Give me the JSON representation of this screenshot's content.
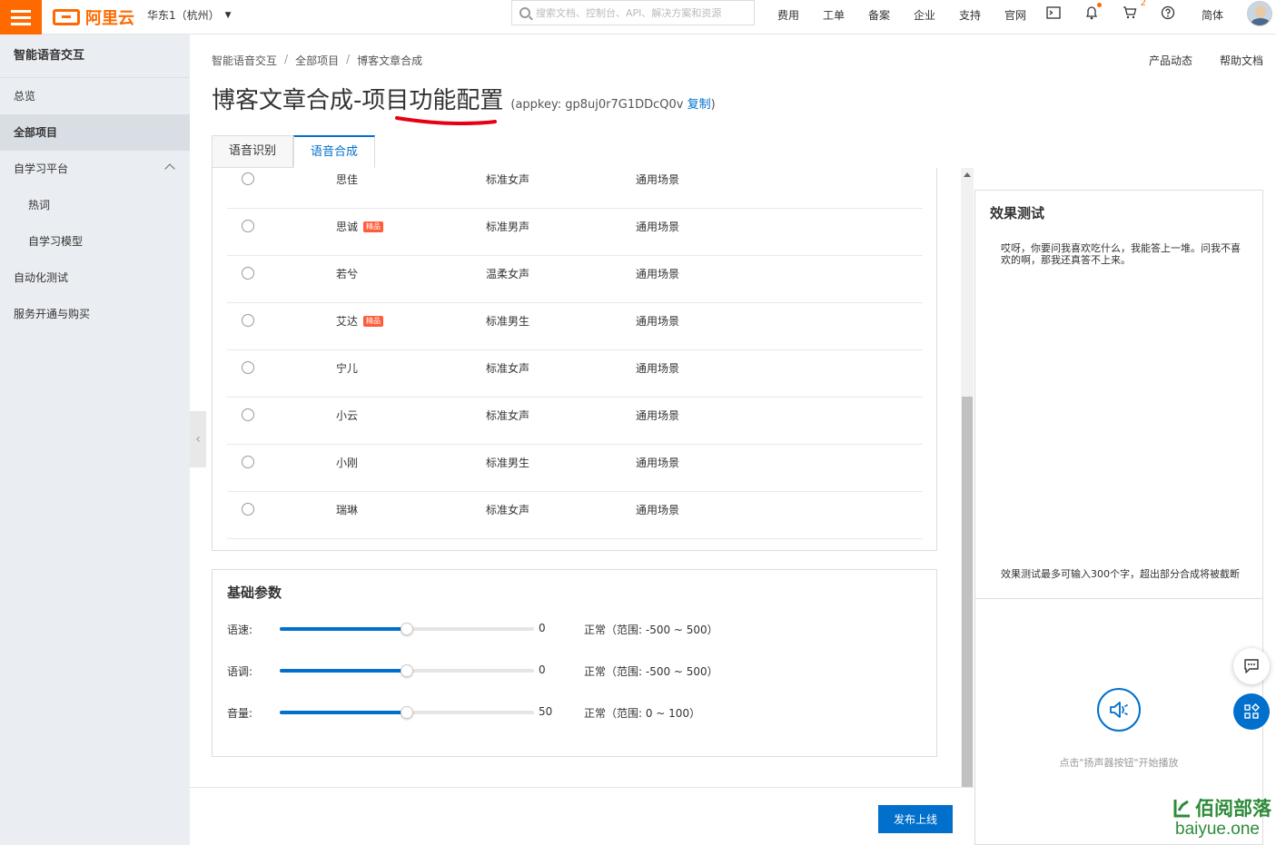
{
  "topbar": {
    "brand": "阿里云",
    "region": "华东1（杭州）",
    "search_placeholder": "搜索文档、控制台、API、解决方案和资源",
    "links": [
      "费用",
      "工单",
      "备案",
      "企业",
      "支持",
      "官网"
    ],
    "cart_badge": "2",
    "lang": "简体",
    "accent": "#ff6a00"
  },
  "sidebar": {
    "title": "智能语音交互",
    "items": [
      {
        "label": "总览"
      },
      {
        "label": "全部项目"
      },
      {
        "label": "自学习平台"
      },
      {
        "label": "热词"
      },
      {
        "label": "自学习模型"
      },
      {
        "label": "自动化测试"
      },
      {
        "label": "服务开通与购买"
      }
    ]
  },
  "breadcrumb": [
    "智能语音交互",
    "全部项目",
    "博客文章合成"
  ],
  "header_links": [
    "产品动态",
    "帮助文档"
  ],
  "title": {
    "text": "博客文章合成-项目功能配置",
    "appkey_prefix": "(appkey: gp8uj0r7G1DDcQ0v",
    "copy": "复制",
    "appkey_suffix": ")"
  },
  "tabs": [
    "语音识别",
    "语音合成"
  ],
  "tag_label": "精品",
  "voices": [
    {
      "name": "思佳",
      "type": "标准女声",
      "scene": "通用场景",
      "premium": false
    },
    {
      "name": "思诚",
      "type": "标准男声",
      "scene": "通用场景",
      "premium": true
    },
    {
      "name": "若兮",
      "type": "温柔女声",
      "scene": "通用场景",
      "premium": false
    },
    {
      "name": "艾达",
      "type": "标准男生",
      "scene": "通用场景",
      "premium": true
    },
    {
      "name": "宁儿",
      "type": "标准女声",
      "scene": "通用场景",
      "premium": false
    },
    {
      "name": "小云",
      "type": "标准女声",
      "scene": "通用场景",
      "premium": false
    },
    {
      "name": "小刚",
      "type": "标准男生",
      "scene": "通用场景",
      "premium": false
    },
    {
      "name": "瑞琳",
      "type": "标准女声",
      "scene": "通用场景",
      "premium": false
    }
  ],
  "params": {
    "title": "基础参数",
    "rows": [
      {
        "label": "语速:",
        "value": "0",
        "range": "正常（范围: -500 ~ 500）",
        "level": 0.5
      },
      {
        "label": "语调:",
        "value": "0",
        "range": "正常（范围: -500 ~ 500）",
        "level": 0.5
      },
      {
        "label": "音量:",
        "value": "50",
        "range": "正常（范围: 0 ~ 100）",
        "level": 0.5
      }
    ]
  },
  "publish_label": "发布上线",
  "test": {
    "title": "效果测试",
    "text": "哎呀，你要问我喜欢吃什么，我能答上一堆。问我不喜欢的啊，那我还真答不上来。",
    "note": "效果测试最多可输入300个字，超出部分合成将被截断",
    "hint": "点击\"扬声器按钮\"开始播放"
  },
  "watermark": {
    "top": "佰阅部落",
    "bottom": "baiyue.one"
  }
}
